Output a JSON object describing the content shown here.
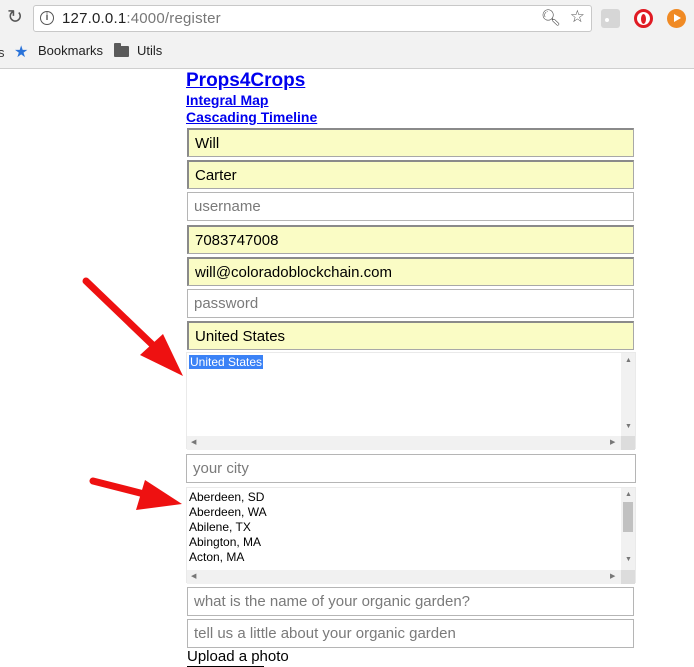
{
  "browser": {
    "url_host": "127.0.0.1",
    "url_path": ":4000/register",
    "bookmarks_bar": {
      "items": [
        {
          "label": "Bookmarks",
          "icon": "star-icon"
        },
        {
          "label": "Utils",
          "icon": "folder-icon"
        }
      ]
    },
    "icons": {
      "reload": "reload-icon",
      "info": "info-icon",
      "zoom": "zoom-icon",
      "bookmark_star": "bookmark-star-icon",
      "ext_rss": "rss-extension-icon",
      "ext_opera": "opera-extension-icon",
      "ext_play": "play-extension-icon"
    }
  },
  "page": {
    "site_title": "Props4Crops",
    "nav": [
      "Integral Map",
      "Cascading Timeline"
    ],
    "form": {
      "first_name": "Will",
      "last_name": "Carter",
      "username_placeholder": "username",
      "phone": "7083747008",
      "email": "will@coloradoblockchain.com",
      "password_placeholder": "password",
      "country": "United States",
      "country_options": [
        "United States"
      ],
      "city_placeholder": "your city",
      "city_options": [
        "Aberdeen, SD",
        "Aberdeen, WA",
        "Abilene, TX",
        "Abington, MA",
        "Acton, MA"
      ],
      "garden_name_placeholder": "what is the name of your organic garden?",
      "garden_desc_placeholder": "tell us a little about your organic garden",
      "upload_label": "Upload a photo"
    },
    "colors": {
      "autofill_bg": "#fafcc5",
      "link": "#0000ee",
      "selection": "#3b82f6",
      "annotation_arrow": "#ee1111"
    }
  }
}
